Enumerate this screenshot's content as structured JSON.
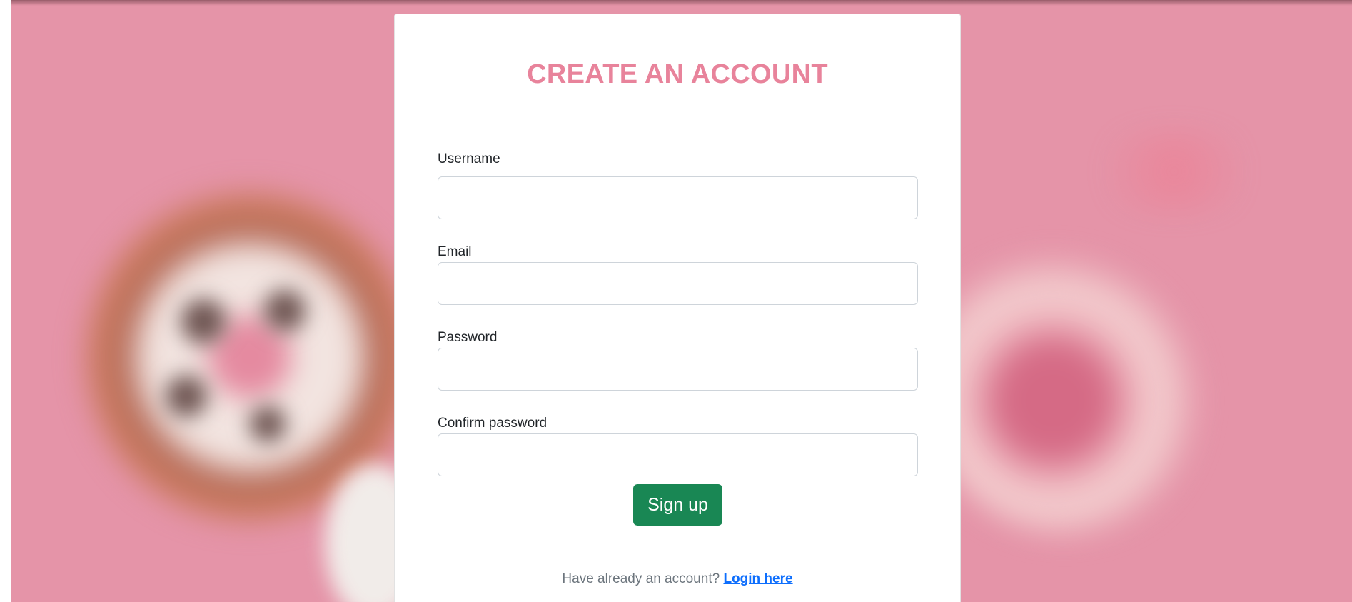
{
  "form": {
    "title": "CREATE AN ACCOUNT",
    "fields": [
      {
        "label": "Username",
        "value": "",
        "placeholder": ""
      },
      {
        "label": "Email",
        "value": "",
        "placeholder": ""
      },
      {
        "label": "Password",
        "value": "",
        "placeholder": ""
      },
      {
        "label": "Confirm password",
        "value": "",
        "placeholder": ""
      }
    ],
    "submit_label": "Sign up",
    "login_prompt": "Have already an account?",
    "login_link": "Login here"
  },
  "colors": {
    "title": "#e8839b",
    "button": "#198754",
    "link": "#0d6efd",
    "background": "#e594a8"
  }
}
